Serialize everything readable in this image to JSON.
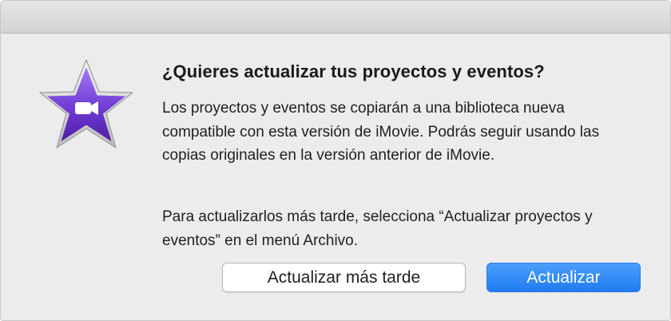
{
  "dialog": {
    "app_icon": "imovie-star-icon",
    "camera_icon": "video-camera-icon",
    "title": "¿Quieres actualizar tus proyectos y eventos?",
    "message_1": "Los proyectos y eventos se copiarán a una biblioteca nueva compatible con esta versión de iMovie. Podrás seguir usando las copias originales en la versión anterior de iMovie.",
    "message_2": "Para actualizarlos más tarde, selecciona “Actualizar proyectos y eventos” en el menú Archivo.",
    "later_button_label": "Actualizar más tarde",
    "update_button_label": "Actualizar"
  },
  "colors": {
    "dialog_background": "#ececec",
    "titlebar": "#dcdcdc",
    "default_button": "#2f8af5",
    "star_purple": "#6a32c4"
  }
}
